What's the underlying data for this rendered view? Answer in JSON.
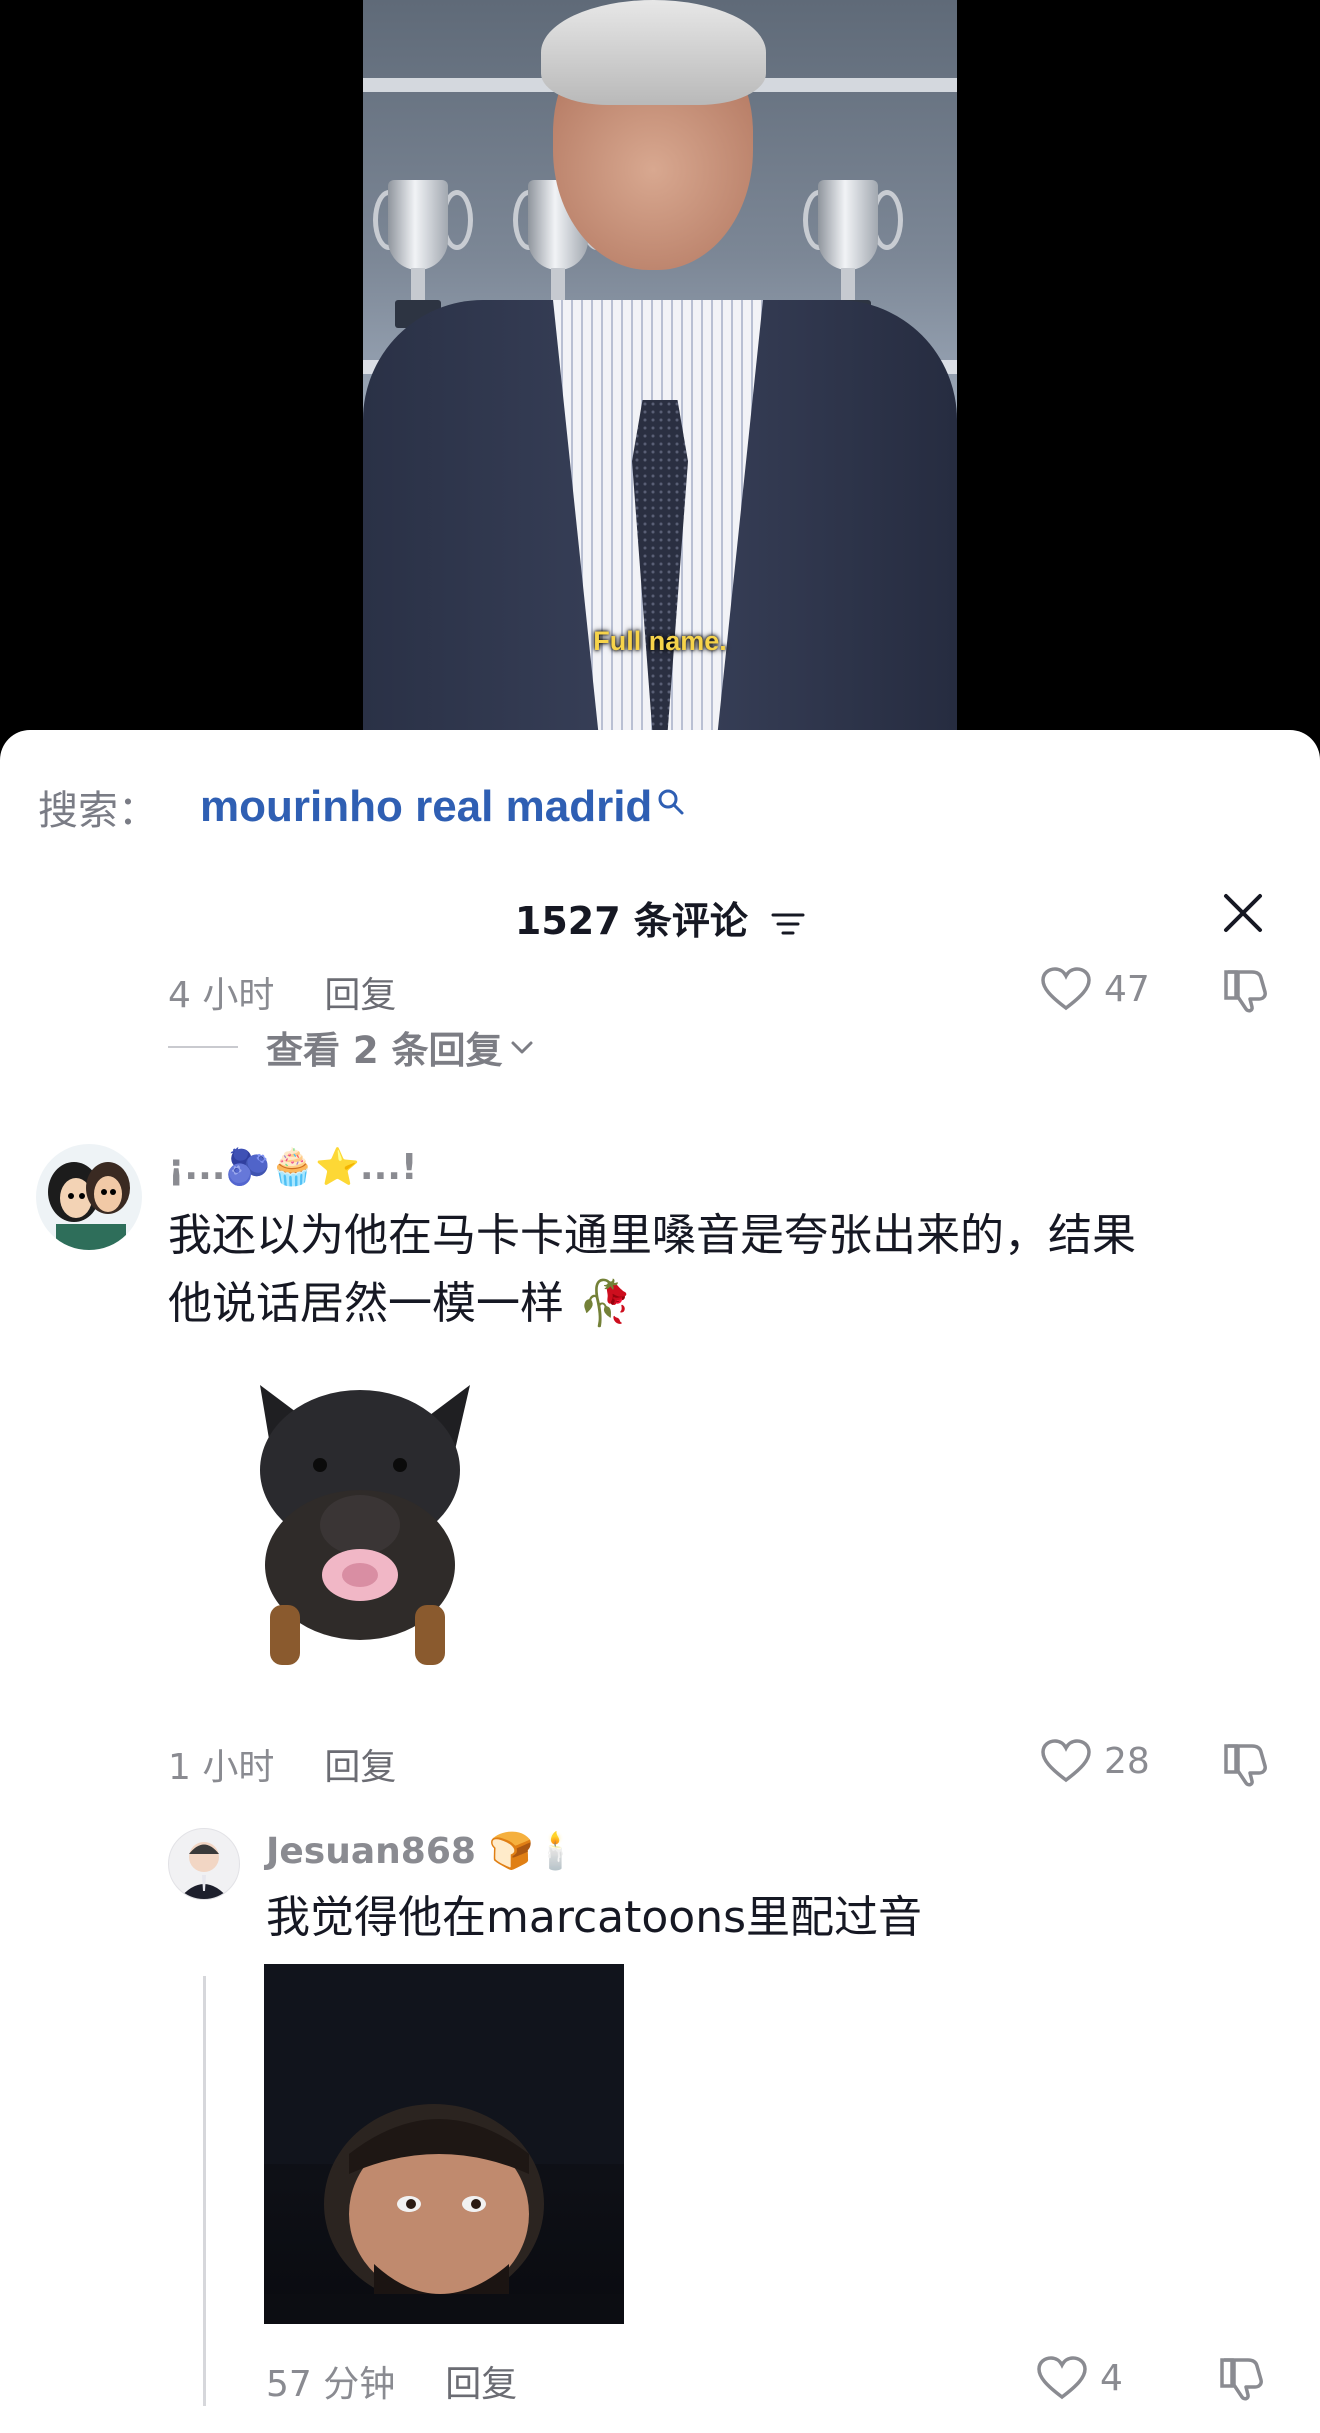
{
  "video": {
    "subtitle": "Full name."
  },
  "search": {
    "label": "搜索：",
    "query": "mourinho real madrid",
    "icon": "search-icon"
  },
  "comments_panel": {
    "title": "1527 条评论",
    "filter_icon": "filter-icon",
    "close_icon": "close-icon"
  },
  "previous_comment": {
    "time": "4 小时",
    "reply_label": "回复",
    "likes": "47",
    "view_replies": "查看 2 条回复"
  },
  "comment": {
    "username": "¡...🫐🧁⭐...!",
    "text_line1": "我还以为他在马卡卡通里嗓音是夸张出来的，结果",
    "text_line2": "他说话居然一模一样 🥀",
    "time": "1 小时",
    "reply_label": "回复",
    "likes": "28"
  },
  "reply": {
    "username": "Jesuan868 🍞🕯️",
    "text": "我觉得他在marcatoons里配过音",
    "time": "57 分钟",
    "reply_label": "回复",
    "likes": "4"
  },
  "colors": {
    "accent_link": "#2f5fb3",
    "subtitle": "#f6d34a",
    "meta_gray": "#8a8b91"
  }
}
